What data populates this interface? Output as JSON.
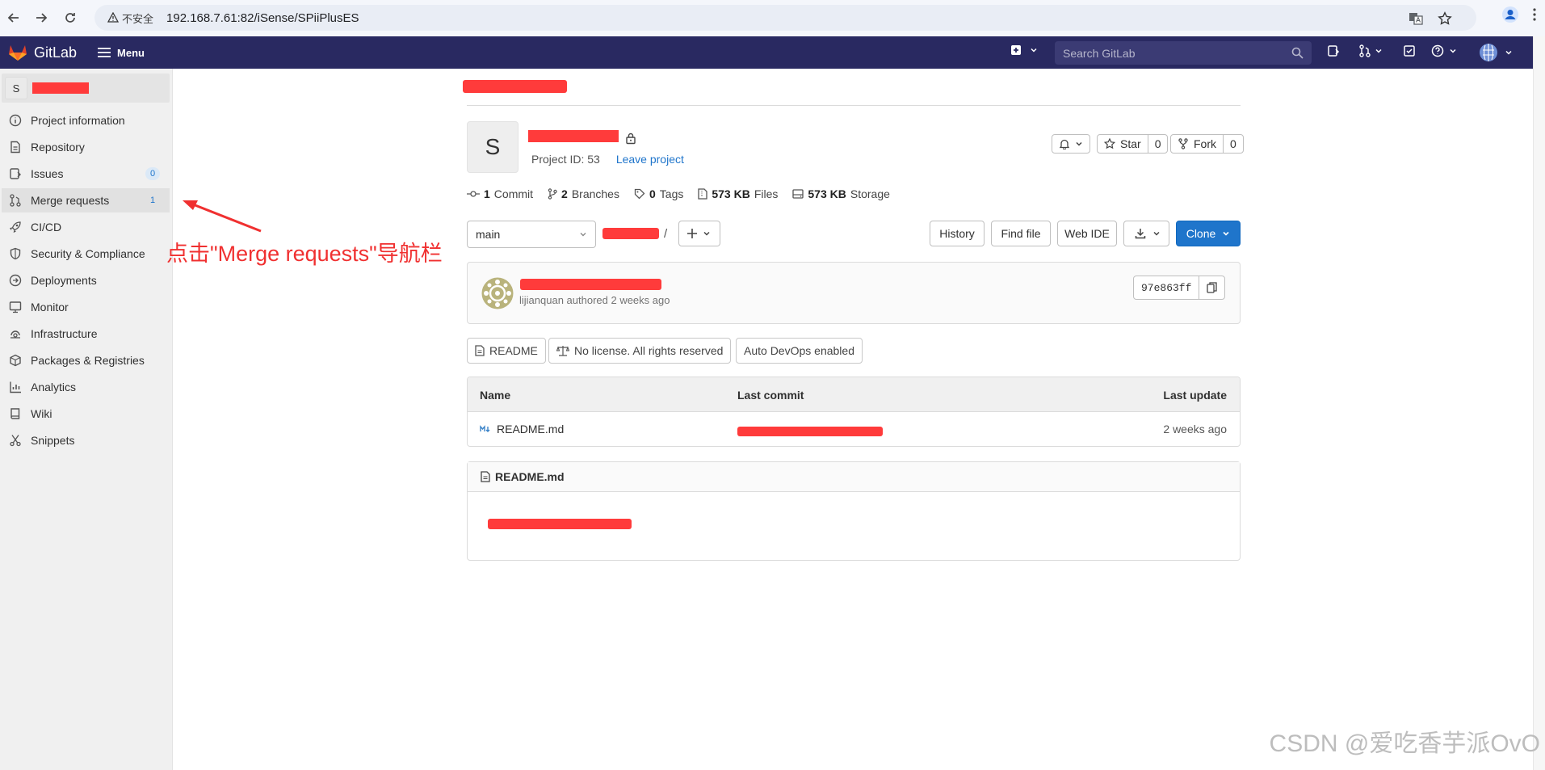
{
  "browser": {
    "security_label": "不安全",
    "url": "192.168.7.61:82/iSense/SPiiPlusES"
  },
  "header": {
    "app_name": "GitLab",
    "menu_label": "Menu",
    "search_placeholder": "Search GitLab"
  },
  "sidebar": {
    "project_initial": "S",
    "items": [
      {
        "label": "Project information",
        "icon": "info-icon"
      },
      {
        "label": "Repository",
        "icon": "doc-icon"
      },
      {
        "label": "Issues",
        "icon": "issues-icon",
        "badge": "0"
      },
      {
        "label": "Merge requests",
        "icon": "merge-icon",
        "badge": "1"
      },
      {
        "label": "CI/CD",
        "icon": "rocket-icon"
      },
      {
        "label": "Security & Compliance",
        "icon": "shield-icon"
      },
      {
        "label": "Deployments",
        "icon": "deploy-icon"
      },
      {
        "label": "Monitor",
        "icon": "monitor-icon"
      },
      {
        "label": "Infrastructure",
        "icon": "infra-icon"
      },
      {
        "label": "Packages & Registries",
        "icon": "package-icon"
      },
      {
        "label": "Analytics",
        "icon": "chart-icon"
      },
      {
        "label": "Wiki",
        "icon": "book-icon"
      },
      {
        "label": "Snippets",
        "icon": "scissors-icon"
      }
    ]
  },
  "annotation": {
    "text": "点击\"Merge requests\"导航栏"
  },
  "project": {
    "initial": "S",
    "project_id": "Project ID: 53",
    "leave_label": "Leave project",
    "star_label": "Star",
    "star_count": "0",
    "fork_label": "Fork",
    "fork_count": "0"
  },
  "stats": {
    "commits_num": "1",
    "commits_label": "Commit",
    "branches_num": "2",
    "branches_label": "Branches",
    "tags_num": "0",
    "tags_label": "Tags",
    "files_num": "573 KB",
    "files_label": "Files",
    "storage_num": "573 KB",
    "storage_label": "Storage"
  },
  "toolbar": {
    "branch": "main",
    "path_sep": "/",
    "history": "History",
    "find_file": "Find file",
    "web_ide": "Web IDE",
    "clone": "Clone"
  },
  "commit": {
    "author_line": "lijianquan authored 2 weeks ago",
    "sha": "97e863ff"
  },
  "badges": {
    "readme": "README",
    "license": "No license. All rights reserved",
    "devops": "Auto DevOps enabled"
  },
  "files_table": {
    "headers": {
      "name": "Name",
      "last_commit": "Last commit",
      "last_update": "Last update"
    },
    "rows": [
      {
        "name": "README.md",
        "last_update": "2 weeks ago"
      }
    ]
  },
  "readme": {
    "title": "README.md"
  },
  "watermark": "CSDN @爱吃香芋派OvO",
  "colors": {
    "header_bg": "#292961",
    "accent_blue": "#1f75cb",
    "annotation_red": "#f03030",
    "redaction_red": "#ff3b3b"
  }
}
